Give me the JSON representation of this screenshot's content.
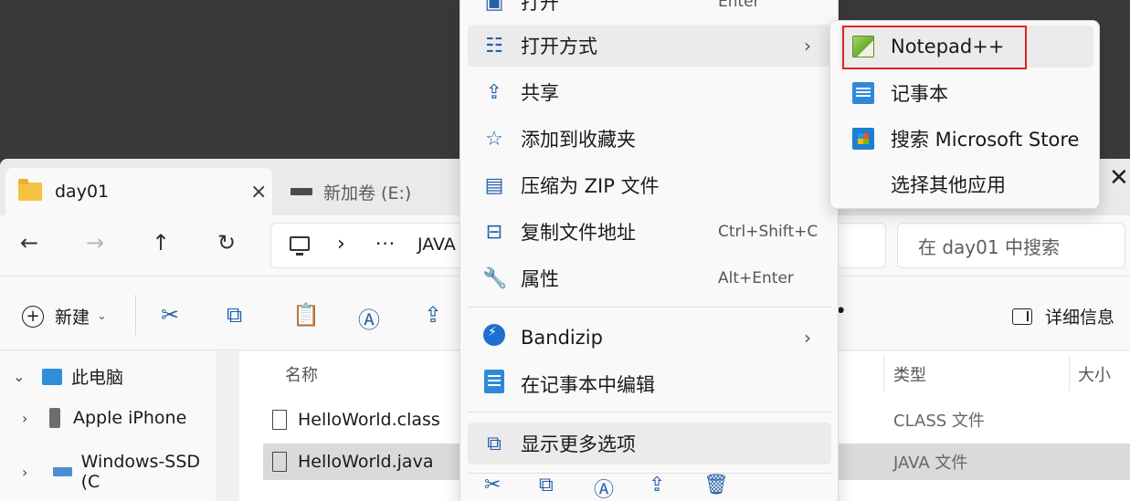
{
  "explorer": {
    "tabs": [
      {
        "label": "day01",
        "active": true
      },
      {
        "label": "新加卷 (E:)",
        "active": false
      }
    ],
    "tab_close": "×",
    "window_close": "✕",
    "address": {
      "more": "···",
      "path": "JAVA"
    },
    "search_placeholder": "在 day01 中搜索",
    "commands": {
      "new_label": "新建",
      "details_label": "详细信息",
      "more": "•"
    },
    "sidebar": [
      {
        "label": "此电脑",
        "icon": "pc-icon",
        "expanded": true
      },
      {
        "label": "Apple iPhone",
        "icon": "phone-icon",
        "expanded": false
      },
      {
        "label": "Windows-SSD (C",
        "icon": "drive-icon",
        "expanded": false
      }
    ],
    "columns": {
      "name": "名称",
      "type": "类型",
      "size": "大小"
    },
    "files": [
      {
        "name": "HelloWorld.class",
        "type": "CLASS 文件",
        "selected": false
      },
      {
        "name": "HelloWorld.java",
        "type": "JAVA 文件",
        "selected": true
      }
    ]
  },
  "context_menu": {
    "items": [
      {
        "label": "打开",
        "accel": "Enter",
        "icon": "open-icon"
      },
      {
        "label": "打开方式",
        "accel": "",
        "icon": "open-with-icon",
        "has_submenu": true,
        "highlighted": true
      },
      {
        "label": "共享",
        "accel": "",
        "icon": "share-icon"
      },
      {
        "label": "添加到收藏夹",
        "accel": "",
        "icon": "star-icon"
      },
      {
        "label": "压缩为 ZIP 文件",
        "accel": "",
        "icon": "zip-icon"
      },
      {
        "label": "复制文件地址",
        "accel": "Ctrl+Shift+C",
        "icon": "copy-path-icon"
      },
      {
        "label": "属性",
        "accel": "Alt+Enter",
        "icon": "wrench-icon"
      },
      {
        "label": "Bandizip",
        "accel": "",
        "icon": "bandizip-icon",
        "has_submenu": true
      },
      {
        "label": "在记事本中编辑",
        "accel": "",
        "icon": "notepad-icon"
      },
      {
        "label": "显示更多选项",
        "accel": "",
        "icon": "more-options-icon",
        "highlighted": true
      }
    ]
  },
  "submenu": {
    "items": [
      {
        "label": "Notepad++",
        "icon": "notepad-plus-plus-icon",
        "highlighted": true
      },
      {
        "label": "记事本",
        "icon": "notepad-icon"
      },
      {
        "label": "搜索 Microsoft Store",
        "icon": "microsoft-store-icon"
      },
      {
        "label": "选择其他应用",
        "icon": ""
      }
    ]
  },
  "colors": {
    "highlight_box": "#e0202a",
    "accent": "#245fa8"
  }
}
